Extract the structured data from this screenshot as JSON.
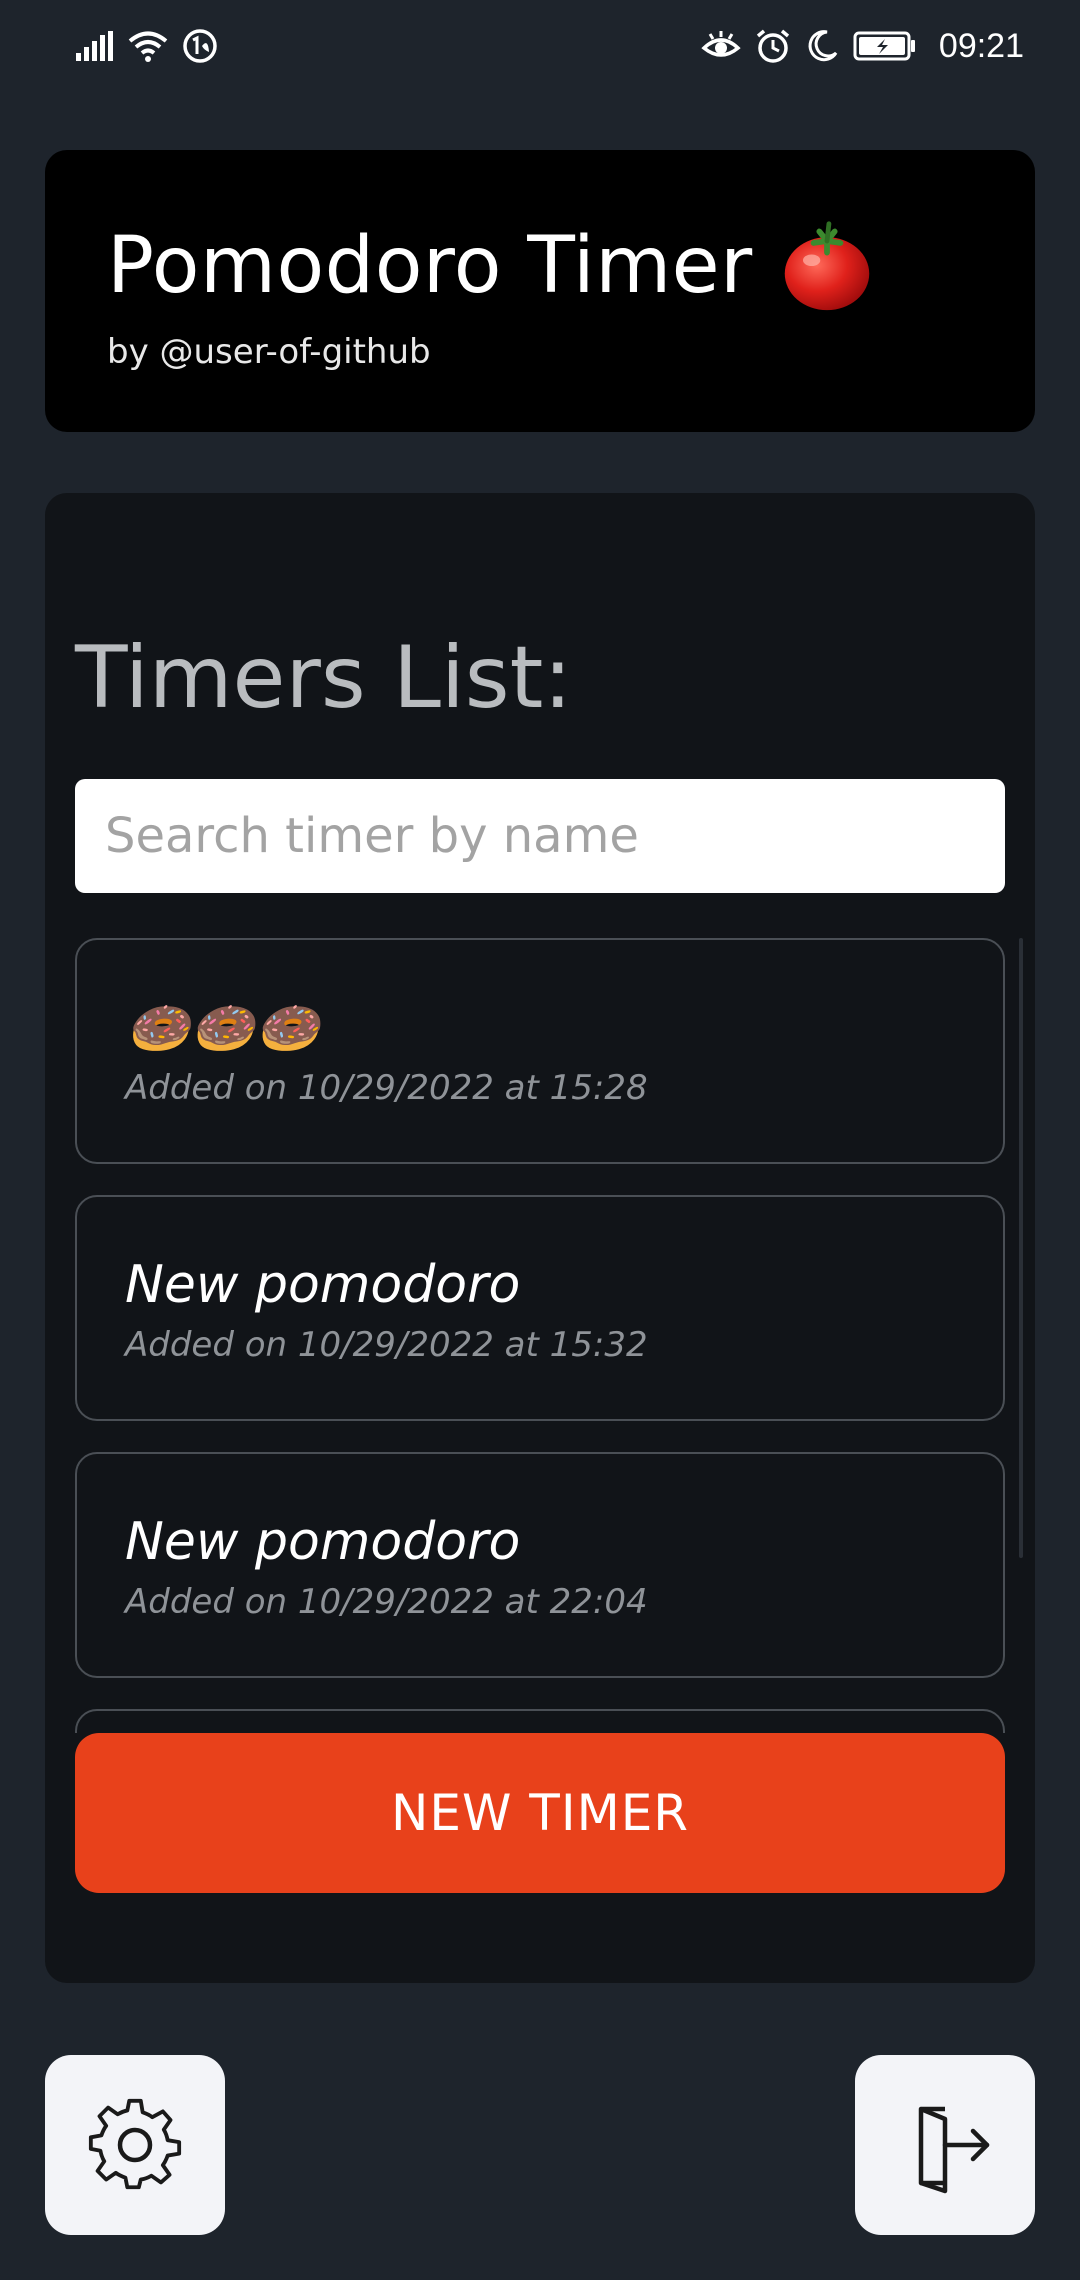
{
  "status_bar": {
    "time": "09:21",
    "icons": [
      "signal-icon",
      "wifi-icon",
      "data-saver-icon",
      "eye-comfort-icon",
      "alarm-icon",
      "moon-icon",
      "battery-charging-icon"
    ]
  },
  "header": {
    "title": "Pomodoro Timer",
    "title_icon": "tomato-icon",
    "subtitle": "by @user-of-github"
  },
  "timers": {
    "title": "Timers List:",
    "search_placeholder": "Search timer by name",
    "items": [
      {
        "name": "🍩🍩🍩",
        "added": "Added on 10/29/2022 at 15:28"
      },
      {
        "name": "New pomodoro",
        "added": "Added on 10/29/2022 at 15:32"
      },
      {
        "name": "New pomodoro",
        "added": "Added on 10/29/2022 at 22:04"
      },
      {
        "name": "",
        "added": ""
      }
    ],
    "new_timer_label": "NEW TIMER"
  },
  "footer": {
    "settings_icon": "gear-icon",
    "logout_icon": "logout-icon"
  },
  "colors": {
    "background": "#1e242c",
    "header_bg": "#000000",
    "card_bg": "#111418",
    "accent": "#e8411b",
    "button_light": "#f3f4f8"
  }
}
